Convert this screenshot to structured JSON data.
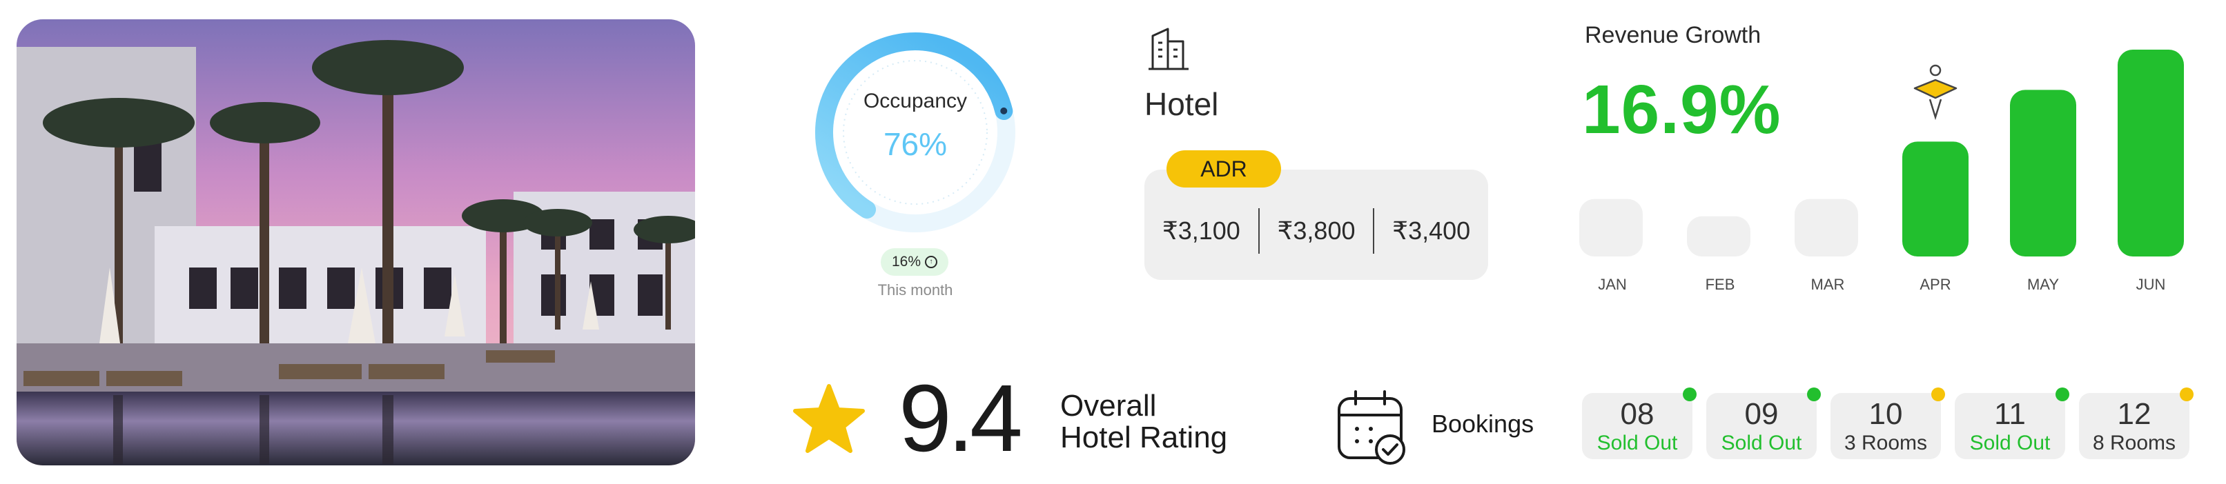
{
  "occupancy": {
    "title": "Occupancy",
    "value": "76%",
    "percent": 76,
    "badge": "16%",
    "badge_icon": "arrow-up-circle-icon",
    "subtitle": "This month"
  },
  "hotel": {
    "title": "Hotel",
    "icon": "building-icon",
    "adr_label": "ADR",
    "adr_values": [
      "₹3,100",
      "₹3,800",
      "₹3,400"
    ]
  },
  "revenue": {
    "title": "Revenue Growth",
    "value": "16.9%",
    "marker_icon": "spark-star-icon"
  },
  "chart_data": {
    "type": "bar",
    "title": "Revenue Growth",
    "categories": [
      "JAN",
      "FEB",
      "MAR",
      "APR",
      "MAY",
      "JUN"
    ],
    "values": [
      20,
      14,
      20,
      40,
      58,
      72
    ],
    "highlighted": [
      false,
      false,
      false,
      true,
      true,
      true
    ],
    "colors": {
      "inactive": "#f0f0f0",
      "active": "#22bf2e"
    }
  },
  "rating": {
    "value": "9.4",
    "label_line1": "Overall",
    "label_line2": "Hotel Rating",
    "icon": "star-icon"
  },
  "bookings": {
    "label": "Bookings",
    "icon": "calendar-check-icon",
    "days": [
      {
        "day": "08",
        "status": "Sold Out",
        "sold_out": true,
        "indicator": "#22bf2e"
      },
      {
        "day": "09",
        "status": "Sold Out",
        "sold_out": true,
        "indicator": "#22bf2e"
      },
      {
        "day": "10",
        "status": "3 Rooms",
        "sold_out": false,
        "indicator": "#f6c308"
      },
      {
        "day": "11",
        "status": "Sold Out",
        "sold_out": true,
        "indicator": "#22bf2e"
      },
      {
        "day": "12",
        "status": "8 Rooms",
        "sold_out": false,
        "indicator": "#f6c308"
      }
    ]
  },
  "colors": {
    "accent_green": "#22bf2e",
    "accent_yellow": "#f6c308",
    "accent_blue": "#5ec6f5"
  }
}
